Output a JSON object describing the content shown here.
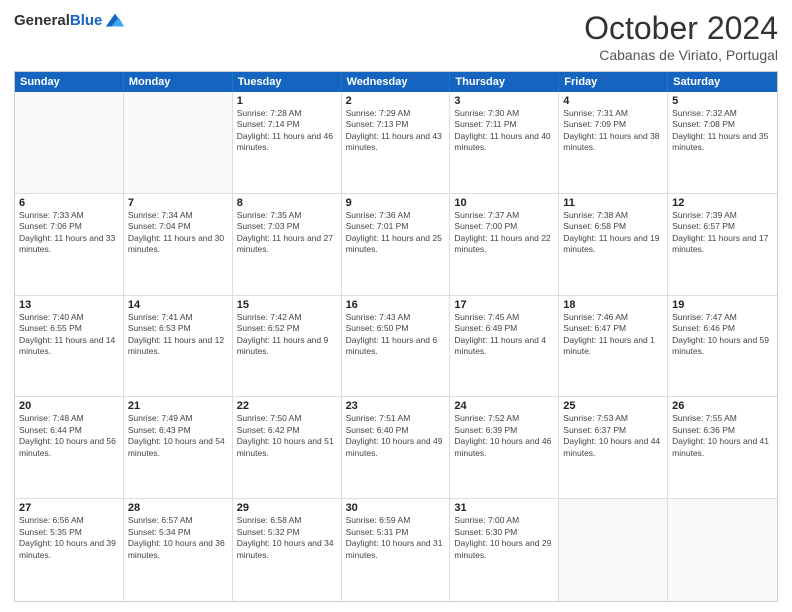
{
  "header": {
    "logo_general": "General",
    "logo_blue": "Blue",
    "month_title": "October 2024",
    "location": "Cabanas de Viriato, Portugal"
  },
  "days_of_week": [
    "Sunday",
    "Monday",
    "Tuesday",
    "Wednesday",
    "Thursday",
    "Friday",
    "Saturday"
  ],
  "weeks": [
    [
      {
        "day": "",
        "sunrise": "",
        "sunset": "",
        "daylight": "",
        "empty": true
      },
      {
        "day": "",
        "sunrise": "",
        "sunset": "",
        "daylight": "",
        "empty": true
      },
      {
        "day": "1",
        "sunrise": "Sunrise: 7:28 AM",
        "sunset": "Sunset: 7:14 PM",
        "daylight": "Daylight: 11 hours and 46 minutes.",
        "empty": false
      },
      {
        "day": "2",
        "sunrise": "Sunrise: 7:29 AM",
        "sunset": "Sunset: 7:13 PM",
        "daylight": "Daylight: 11 hours and 43 minutes.",
        "empty": false
      },
      {
        "day": "3",
        "sunrise": "Sunrise: 7:30 AM",
        "sunset": "Sunset: 7:11 PM",
        "daylight": "Daylight: 11 hours and 40 minutes.",
        "empty": false
      },
      {
        "day": "4",
        "sunrise": "Sunrise: 7:31 AM",
        "sunset": "Sunset: 7:09 PM",
        "daylight": "Daylight: 11 hours and 38 minutes.",
        "empty": false
      },
      {
        "day": "5",
        "sunrise": "Sunrise: 7:32 AM",
        "sunset": "Sunset: 7:08 PM",
        "daylight": "Daylight: 11 hours and 35 minutes.",
        "empty": false
      }
    ],
    [
      {
        "day": "6",
        "sunrise": "Sunrise: 7:33 AM",
        "sunset": "Sunset: 7:06 PM",
        "daylight": "Daylight: 11 hours and 33 minutes.",
        "empty": false
      },
      {
        "day": "7",
        "sunrise": "Sunrise: 7:34 AM",
        "sunset": "Sunset: 7:04 PM",
        "daylight": "Daylight: 11 hours and 30 minutes.",
        "empty": false
      },
      {
        "day": "8",
        "sunrise": "Sunrise: 7:35 AM",
        "sunset": "Sunset: 7:03 PM",
        "daylight": "Daylight: 11 hours and 27 minutes.",
        "empty": false
      },
      {
        "day": "9",
        "sunrise": "Sunrise: 7:36 AM",
        "sunset": "Sunset: 7:01 PM",
        "daylight": "Daylight: 11 hours and 25 minutes.",
        "empty": false
      },
      {
        "day": "10",
        "sunrise": "Sunrise: 7:37 AM",
        "sunset": "Sunset: 7:00 PM",
        "daylight": "Daylight: 11 hours and 22 minutes.",
        "empty": false
      },
      {
        "day": "11",
        "sunrise": "Sunrise: 7:38 AM",
        "sunset": "Sunset: 6:58 PM",
        "daylight": "Daylight: 11 hours and 19 minutes.",
        "empty": false
      },
      {
        "day": "12",
        "sunrise": "Sunrise: 7:39 AM",
        "sunset": "Sunset: 6:57 PM",
        "daylight": "Daylight: 11 hours and 17 minutes.",
        "empty": false
      }
    ],
    [
      {
        "day": "13",
        "sunrise": "Sunrise: 7:40 AM",
        "sunset": "Sunset: 6:55 PM",
        "daylight": "Daylight: 11 hours and 14 minutes.",
        "empty": false
      },
      {
        "day": "14",
        "sunrise": "Sunrise: 7:41 AM",
        "sunset": "Sunset: 6:53 PM",
        "daylight": "Daylight: 11 hours and 12 minutes.",
        "empty": false
      },
      {
        "day": "15",
        "sunrise": "Sunrise: 7:42 AM",
        "sunset": "Sunset: 6:52 PM",
        "daylight": "Daylight: 11 hours and 9 minutes.",
        "empty": false
      },
      {
        "day": "16",
        "sunrise": "Sunrise: 7:43 AM",
        "sunset": "Sunset: 6:50 PM",
        "daylight": "Daylight: 11 hours and 6 minutes.",
        "empty": false
      },
      {
        "day": "17",
        "sunrise": "Sunrise: 7:45 AM",
        "sunset": "Sunset: 6:49 PM",
        "daylight": "Daylight: 11 hours and 4 minutes.",
        "empty": false
      },
      {
        "day": "18",
        "sunrise": "Sunrise: 7:46 AM",
        "sunset": "Sunset: 6:47 PM",
        "daylight": "Daylight: 11 hours and 1 minute.",
        "empty": false
      },
      {
        "day": "19",
        "sunrise": "Sunrise: 7:47 AM",
        "sunset": "Sunset: 6:46 PM",
        "daylight": "Daylight: 10 hours and 59 minutes.",
        "empty": false
      }
    ],
    [
      {
        "day": "20",
        "sunrise": "Sunrise: 7:48 AM",
        "sunset": "Sunset: 6:44 PM",
        "daylight": "Daylight: 10 hours and 56 minutes.",
        "empty": false
      },
      {
        "day": "21",
        "sunrise": "Sunrise: 7:49 AM",
        "sunset": "Sunset: 6:43 PM",
        "daylight": "Daylight: 10 hours and 54 minutes.",
        "empty": false
      },
      {
        "day": "22",
        "sunrise": "Sunrise: 7:50 AM",
        "sunset": "Sunset: 6:42 PM",
        "daylight": "Daylight: 10 hours and 51 minutes.",
        "empty": false
      },
      {
        "day": "23",
        "sunrise": "Sunrise: 7:51 AM",
        "sunset": "Sunset: 6:40 PM",
        "daylight": "Daylight: 10 hours and 49 minutes.",
        "empty": false
      },
      {
        "day": "24",
        "sunrise": "Sunrise: 7:52 AM",
        "sunset": "Sunset: 6:39 PM",
        "daylight": "Daylight: 10 hours and 46 minutes.",
        "empty": false
      },
      {
        "day": "25",
        "sunrise": "Sunrise: 7:53 AM",
        "sunset": "Sunset: 6:37 PM",
        "daylight": "Daylight: 10 hours and 44 minutes.",
        "empty": false
      },
      {
        "day": "26",
        "sunrise": "Sunrise: 7:55 AM",
        "sunset": "Sunset: 6:36 PM",
        "daylight": "Daylight: 10 hours and 41 minutes.",
        "empty": false
      }
    ],
    [
      {
        "day": "27",
        "sunrise": "Sunrise: 6:56 AM",
        "sunset": "Sunset: 5:35 PM",
        "daylight": "Daylight: 10 hours and 39 minutes.",
        "empty": false
      },
      {
        "day": "28",
        "sunrise": "Sunrise: 6:57 AM",
        "sunset": "Sunset: 5:34 PM",
        "daylight": "Daylight: 10 hours and 36 minutes.",
        "empty": false
      },
      {
        "day": "29",
        "sunrise": "Sunrise: 6:58 AM",
        "sunset": "Sunset: 5:32 PM",
        "daylight": "Daylight: 10 hours and 34 minutes.",
        "empty": false
      },
      {
        "day": "30",
        "sunrise": "Sunrise: 6:59 AM",
        "sunset": "Sunset: 5:31 PM",
        "daylight": "Daylight: 10 hours and 31 minutes.",
        "empty": false
      },
      {
        "day": "31",
        "sunrise": "Sunrise: 7:00 AM",
        "sunset": "Sunset: 5:30 PM",
        "daylight": "Daylight: 10 hours and 29 minutes.",
        "empty": false
      },
      {
        "day": "",
        "sunrise": "",
        "sunset": "",
        "daylight": "",
        "empty": true
      },
      {
        "day": "",
        "sunrise": "",
        "sunset": "",
        "daylight": "",
        "empty": true
      }
    ]
  ]
}
